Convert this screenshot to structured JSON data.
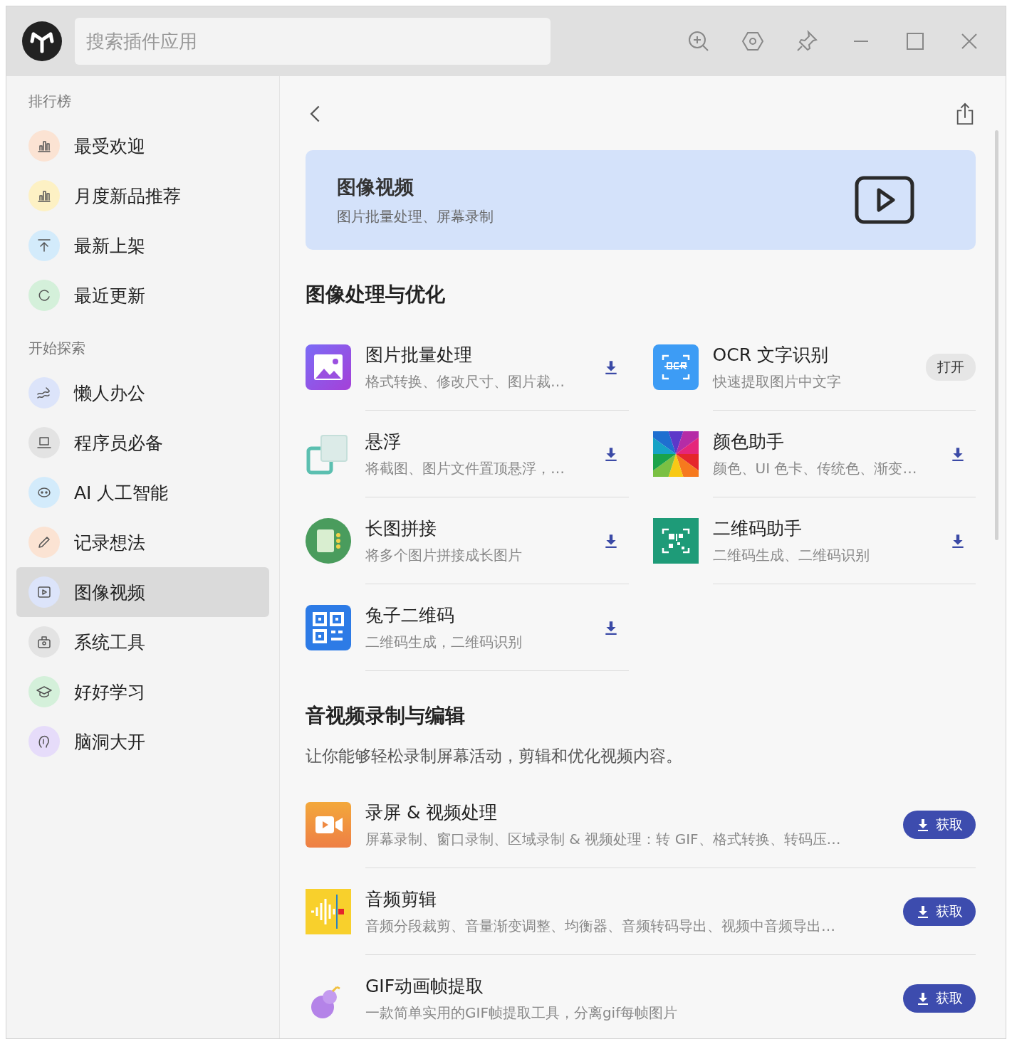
{
  "search": {
    "placeholder": "搜索插件应用"
  },
  "sidebar": {
    "sections": [
      {
        "title": "排行榜",
        "items": [
          {
            "label": "最受欢迎",
            "kind": "chart",
            "color": "#fbe3d3",
            "selected": false
          },
          {
            "label": "月度新品推荐",
            "kind": "chart",
            "color": "#fdf1c4",
            "selected": false
          },
          {
            "label": "最新上架",
            "kind": "upload",
            "color": "#d3ebfb",
            "selected": false
          },
          {
            "label": "最近更新",
            "kind": "refresh",
            "color": "#d4f0da",
            "selected": false
          }
        ]
      },
      {
        "title": "开始探索",
        "items": [
          {
            "label": "懒人办公",
            "kind": "wave",
            "color": "#dce4fa",
            "selected": false
          },
          {
            "label": "程序员必备",
            "kind": "laptop",
            "color": "#e3e3e3",
            "selected": false
          },
          {
            "label": "AI 人工智能",
            "kind": "robot",
            "color": "#d3ebfb",
            "selected": false
          },
          {
            "label": "记录想法",
            "kind": "pencil",
            "color": "#fbe3d3",
            "selected": false
          },
          {
            "label": "图像视频",
            "kind": "play",
            "color": "#dce4fa",
            "selected": true
          },
          {
            "label": "系统工具",
            "kind": "toolbox",
            "color": "#e3e3e3",
            "selected": false
          },
          {
            "label": "好好学习",
            "kind": "cap",
            "color": "#d4f0da",
            "selected": false
          },
          {
            "label": "脑洞大开",
            "kind": "brain",
            "color": "#e6dcfa",
            "selected": false
          }
        ]
      }
    ]
  },
  "banner": {
    "title": "图像视频",
    "subtitle": "图片批量处理、屏幕录制"
  },
  "sections": [
    {
      "title": "图像处理与优化",
      "kind": "grid",
      "apps": [
        {
          "name": "图片批量处理",
          "desc": "格式转换、修改尺寸、图片裁…",
          "kind": "gallery",
          "button": {
            "kind": "download"
          }
        },
        {
          "name": "OCR 文字识别",
          "desc": "快速提取图片中文字",
          "kind": "ocr",
          "button": {
            "kind": "open",
            "label": "打开"
          }
        },
        {
          "name": "悬浮",
          "desc": "将截图、图片文件置顶悬浮，…",
          "kind": "float",
          "button": {
            "kind": "download"
          }
        },
        {
          "name": "颜色助手",
          "desc": "颜色、UI 色卡、传统色、渐变…",
          "kind": "colorwheel",
          "button": {
            "kind": "download"
          }
        },
        {
          "name": "长图拼接",
          "desc": "将多个图片拼接成长图片",
          "kind": "longimage",
          "button": {
            "kind": "download"
          }
        },
        {
          "name": "二维码助手",
          "desc": "二维码生成、二维码识别",
          "kind": "qrgreen",
          "button": {
            "kind": "download"
          }
        },
        {
          "name": "兔子二维码",
          "desc": "二维码生成，二维码识别",
          "kind": "qrblue",
          "button": {
            "kind": "download"
          }
        }
      ]
    },
    {
      "title": "音视频录制与编辑",
      "kind": "list",
      "description": "让你能够轻松录制屏幕活动，剪辑和优化视频内容。",
      "apps": [
        {
          "name": "录屏 & 视频处理",
          "desc": "屏幕录制、窗口录制、区域录制 & 视频处理：转 GIF、格式转换、转码压…",
          "kind": "video",
          "button": {
            "kind": "get",
            "label": "获取"
          }
        },
        {
          "name": "音频剪辑",
          "desc": "音频分段裁剪、音量渐变调整、均衡器、音频转码导出、视频中音频导出…",
          "kind": "audio",
          "button": {
            "kind": "get",
            "label": "获取"
          }
        },
        {
          "name": "GIF动画帧提取",
          "desc": "一款简单实用的GIF帧提取工具，分离gif每帧图片",
          "kind": "gourd",
          "button": {
            "kind": "get",
            "label": "获取"
          }
        }
      ]
    }
  ]
}
